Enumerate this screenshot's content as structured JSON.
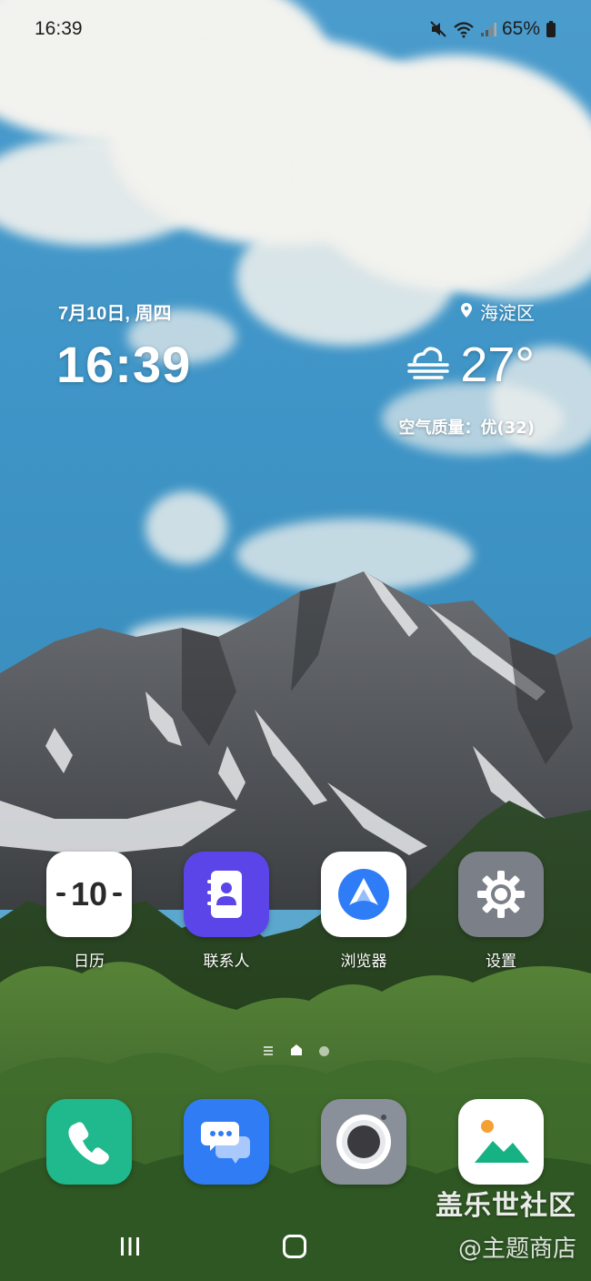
{
  "status_bar": {
    "time": "16:39",
    "battery": "65%",
    "icons": [
      "mute-icon",
      "wifi-icon",
      "signal-icon",
      "battery-icon"
    ]
  },
  "widget": {
    "date": "7月10日, 周四",
    "time": "16:39",
    "location": "海淀区",
    "temperature": "27°",
    "air_quality": "空气质量：优(32)",
    "weather_icon": "fog-icon"
  },
  "apps": [
    {
      "label": "日历",
      "icon": "calendar-icon",
      "day": "10"
    },
    {
      "label": "联系人",
      "icon": "contacts-icon"
    },
    {
      "label": "浏览器",
      "icon": "browser-icon"
    },
    {
      "label": "设置",
      "icon": "settings-icon"
    }
  ],
  "dock": [
    {
      "icon": "phone-icon"
    },
    {
      "icon": "messages-icon"
    },
    {
      "icon": "camera-icon"
    },
    {
      "icon": "gallery-icon"
    }
  ],
  "watermark": {
    "title": "盖乐世社区",
    "subtitle": "@主题商店"
  },
  "colors": {
    "contacts": "#5b45e8",
    "browser_blue": "#2f7df6",
    "settings_gray": "#7b8088",
    "phone_green": "#1fb98d",
    "messages_blue": "#2f7cf5",
    "camera_gray": "#8a9099",
    "gallery_green": "#16b283",
    "gallery_orange": "#f5a033"
  }
}
